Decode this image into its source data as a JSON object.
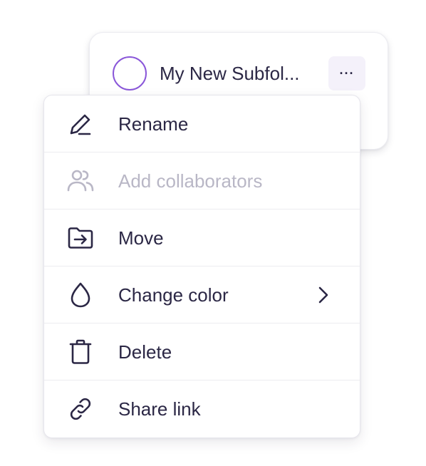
{
  "folder": {
    "name": "My New Subfol...",
    "icon": "circle-outline-icon",
    "circle_color": "#8a57d9",
    "more_label": "···"
  },
  "menu": {
    "items": [
      {
        "label": "Rename",
        "icon": "pencil-icon",
        "disabled": false
      },
      {
        "label": "Add collaborators",
        "icon": "users-icon",
        "disabled": true
      },
      {
        "label": "Move",
        "icon": "folder-move-icon",
        "disabled": false
      },
      {
        "label": "Change color",
        "icon": "droplet-icon",
        "disabled": false,
        "submenu": true
      },
      {
        "label": "Delete",
        "icon": "trash-icon",
        "disabled": false
      },
      {
        "label": "Share link",
        "icon": "link-icon",
        "disabled": false
      }
    ]
  },
  "colors": {
    "text": "#2b2745",
    "disabled_text": "#b9b7c6",
    "accent": "#8a57d9"
  }
}
